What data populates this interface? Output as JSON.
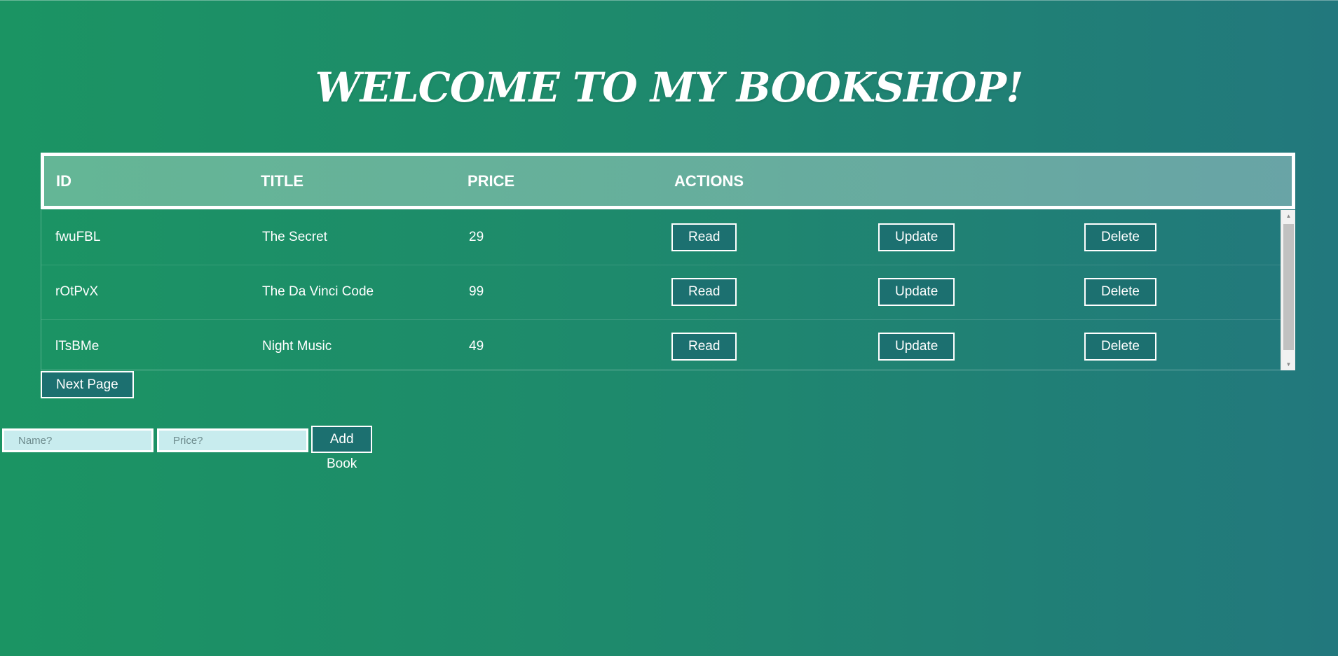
{
  "header": {
    "title": "WELCOME TO MY BOOKSHOP!"
  },
  "table": {
    "columns": [
      "ID",
      "TITLE",
      "PRICE",
      "ACTIONS"
    ],
    "rows": [
      {
        "id": "fwuFBL",
        "title": "The Secret",
        "price": "29"
      },
      {
        "id": "rOtPvX",
        "title": "The Da Vinci Code",
        "price": "99"
      },
      {
        "id": "lTsBMe",
        "title": "Night Music",
        "price": "49"
      }
    ],
    "actions": {
      "read_label": "Read",
      "update_label": "Update",
      "delete_label": "Delete"
    },
    "scrollbar": {
      "up_icon": "arrow-up-icon",
      "down_icon": "arrow-down-icon"
    }
  },
  "pagination": {
    "next_label": "Next Page"
  },
  "add_form": {
    "name_placeholder": "Name?",
    "price_placeholder": "Price?",
    "submit_label": "Add Book"
  },
  "colors": {
    "background_start": "#1b9463",
    "background_end": "#22787d",
    "button_fill": "#1c7070",
    "input_fill": "#c8ecee",
    "text": "#ffffff"
  }
}
